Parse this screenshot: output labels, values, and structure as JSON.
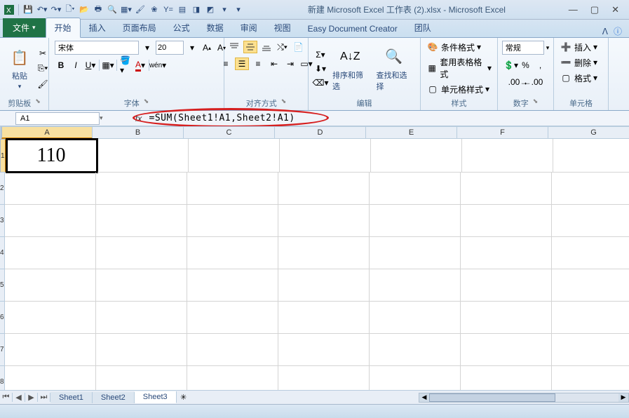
{
  "title": {
    "filename": "新建 Microsoft Excel 工作表 (2).xlsx",
    "app": "Microsoft Excel"
  },
  "qat_icons": [
    "excel",
    "save",
    "undo",
    "redo",
    "new",
    "open",
    "print",
    "preview",
    "table",
    "brush",
    "sort",
    "fx",
    "grid",
    "chart",
    "macro",
    "drop1",
    "drop2"
  ],
  "tabs": {
    "file": "文件",
    "items": [
      "开始",
      "插入",
      "页面布局",
      "公式",
      "数据",
      "审阅",
      "视图",
      "Easy Document Creator",
      "团队"
    ],
    "active": 0
  },
  "ribbon": {
    "clipboard": {
      "label": "剪贴板",
      "paste": "粘贴"
    },
    "font": {
      "label": "字体",
      "name": "宋体",
      "size": "20"
    },
    "align": {
      "label": "对齐方式"
    },
    "editing": {
      "label": "编辑",
      "sort": "排序和筛选",
      "find": "查找和选择"
    },
    "styles": {
      "label": "样式",
      "cond": "条件格式",
      "table": "套用表格格式",
      "cell": "单元格样式"
    },
    "number": {
      "label": "数字",
      "format": "常规"
    },
    "cells": {
      "label": "单元格",
      "insert": "插入",
      "delete": "删除",
      "format": "格式"
    }
  },
  "name_box": "A1",
  "formula": "=SUM(Sheet1!A1,Sheet2!A1)",
  "columns": [
    "A",
    "B",
    "C",
    "D",
    "E",
    "F",
    "G"
  ],
  "rows": [
    "1",
    "2",
    "3",
    "4",
    "5",
    "6",
    "7",
    "8"
  ],
  "cell_A1": "110",
  "sheets": {
    "items": [
      "Sheet1",
      "Sheet2",
      "Sheet3"
    ],
    "active": 2
  }
}
